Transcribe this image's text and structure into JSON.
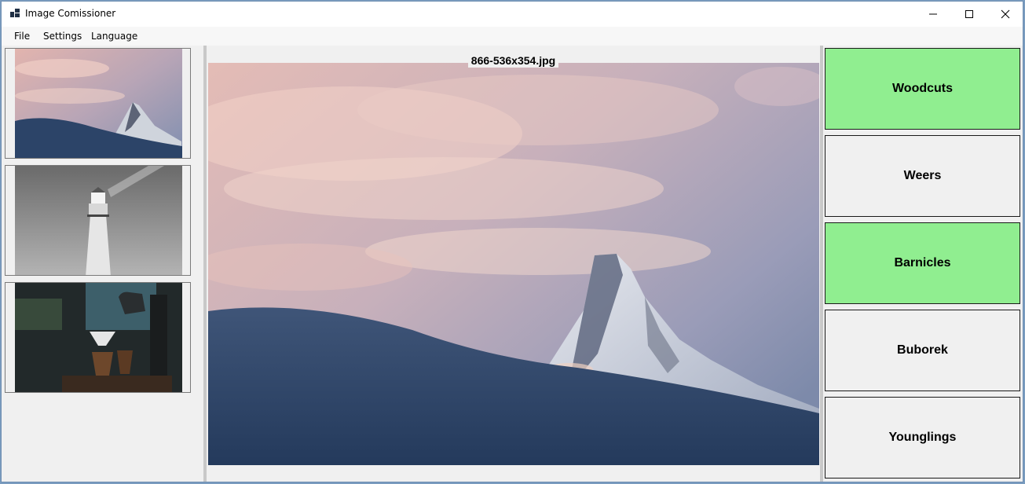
{
  "window": {
    "title": "Image Comissioner"
  },
  "menu": {
    "items": [
      "File",
      "Settings",
      "Language"
    ]
  },
  "thumbnails": [
    {
      "icon": "mountain-sunset-thumbnail"
    },
    {
      "icon": "lighthouse-thumbnail"
    },
    {
      "icon": "coffee-bar-thumbnail"
    }
  ],
  "viewer": {
    "filename": "866-536x354.jpg"
  },
  "categories": [
    {
      "label": "Woodcuts",
      "selected": true
    },
    {
      "label": "Weers",
      "selected": false
    },
    {
      "label": "Barnicles",
      "selected": true
    },
    {
      "label": "Buborek",
      "selected": false
    },
    {
      "label": "Younglings",
      "selected": false
    }
  ],
  "colors": {
    "selected": "#90ee90",
    "unselected": "#f0f0f0"
  }
}
